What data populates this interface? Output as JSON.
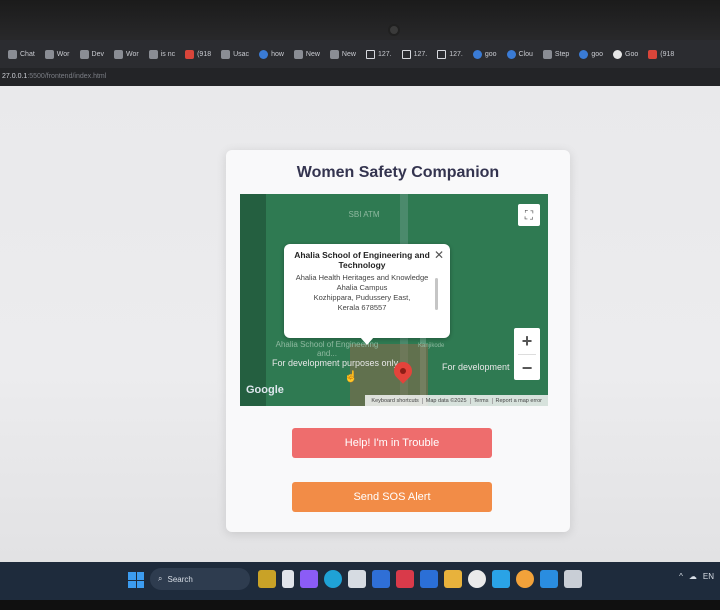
{
  "browser": {
    "tabs": [
      {
        "label": "Chat",
        "icon": "chat-icon"
      },
      {
        "label": "Wor",
        "icon": "globe-icon"
      },
      {
        "label": "Dev",
        "icon": "dev-icon"
      },
      {
        "label": "Wor",
        "icon": "page-icon"
      },
      {
        "label": "is nc",
        "icon": "page-icon"
      },
      {
        "label": "(918",
        "icon": "youtube-icon"
      },
      {
        "label": "Usac",
        "icon": "page-icon"
      },
      {
        "label": "how",
        "icon": "search-icon"
      },
      {
        "label": "New",
        "icon": "newtab-icon"
      },
      {
        "label": "New",
        "icon": "newtab-icon"
      },
      {
        "label": "127.",
        "icon": "doc-icon"
      },
      {
        "label": "127.",
        "icon": "doc-icon"
      },
      {
        "label": "127.",
        "icon": "doc-icon"
      },
      {
        "label": "goo",
        "icon": "search-icon"
      },
      {
        "label": "Clou",
        "icon": "cloud-icon"
      },
      {
        "label": "Step",
        "icon": "page-icon"
      },
      {
        "label": "goo",
        "icon": "search-icon"
      },
      {
        "label": "Goo",
        "icon": "google-icon"
      },
      {
        "label": "(918",
        "icon": "youtube-icon"
      }
    ],
    "address": {
      "host": "27.0.0.1",
      "path": ":5500/frontend/index.html"
    }
  },
  "app": {
    "title": "Women Safety Companion",
    "map": {
      "poi_atm": "SBI ATM",
      "poi_school_label": "Ahalia School of Engineering and...",
      "dev_text_left": "For development purposes only",
      "dev_text_right": "For development",
      "road_label": "Kanjikode",
      "info_window": {
        "title": "Ahalia School of Engineering and Technology",
        "address_lines": [
          "Ahalia Health Heritages and Knowledge",
          "Ahalia Campus",
          "Kozhippara, Pudussery East,",
          "Kerala 678557"
        ]
      },
      "google_label": "Google",
      "attribution": [
        "Keyboard shortcuts",
        "Map data ©2025",
        "Terms",
        "Report a map error"
      ],
      "zoom_in": "+",
      "zoom_out": "−"
    },
    "buttons": {
      "help_label": "Help! I'm in Trouble",
      "sos_label": "Send SOS Alert"
    },
    "colors": {
      "help_button": "#ee6d6d",
      "sos_button": "#f28c47",
      "title": "#34344f",
      "map_green": "#2f7a52"
    }
  },
  "taskbar": {
    "search_label": "Search",
    "tray_text": "EN"
  }
}
